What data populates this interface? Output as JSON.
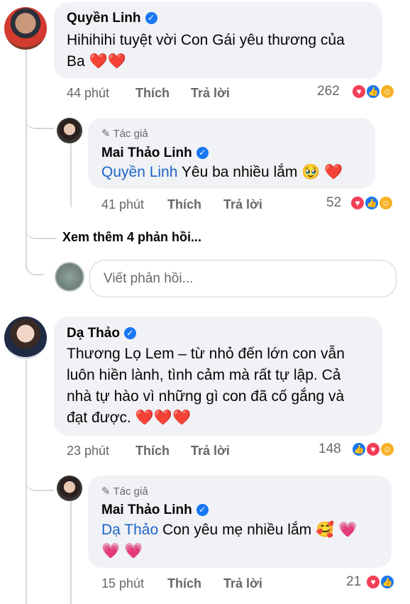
{
  "comments": [
    {
      "author": "Quyền Linh",
      "text_line1": "Hihihihi tuyệt vời Con Gái yêu thương của",
      "text_line2": "Ba",
      "time": "44 phút",
      "like": "Thích",
      "reply": "Trả lời",
      "reaction_count": "262",
      "reactions": [
        "love-icon",
        "like-icon",
        "care-icon"
      ]
    },
    {
      "author": "Dạ Thảo",
      "text_lines": [
        "Thương Lọ Lem – từ nhỏ đến lớn con vẫn",
        "luôn hiền lành, tình cảm mà rất tự lập. Cả",
        "nhà tự hào vì những gì con đã cố gắng và",
        "đạt được."
      ],
      "time": "23 phút",
      "like": "Thích",
      "reply": "Trả lời",
      "reaction_count": "148",
      "reactions": [
        "like-icon",
        "love-icon",
        "care-icon"
      ]
    }
  ],
  "replies": [
    {
      "author_tag": "Tác giả",
      "author": "Mai Thảo Linh",
      "mention": "Quyền Linh",
      "text": "Yêu ba nhiều lắm",
      "time": "41 phút",
      "like": "Thích",
      "reply": "Trả lời",
      "reaction_count": "52"
    },
    {
      "author_tag": "Tác giả",
      "author": "Mai Thảo Linh",
      "mention": "Dạ Thảo",
      "text": "Con yêu mẹ nhiều lắm",
      "time": "15 phút",
      "like": "Thích",
      "reply": "Trả lời",
      "reaction_count": "21"
    }
  ],
  "see_more": "Xem thêm 4 phản hồi...",
  "reply_input": {
    "placeholder": "Viết phản hồi..."
  },
  "colors": {
    "mention": "#1d65c9",
    "bubble": "#f0f2f5",
    "verified": "#1877f2"
  }
}
